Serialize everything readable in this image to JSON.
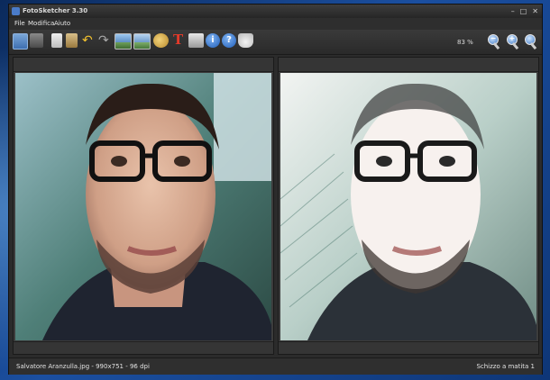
{
  "window": {
    "title": "FotoSketcher 3.30",
    "controls": [
      "–",
      "□",
      "✕"
    ]
  },
  "menu": {
    "items": [
      "File",
      "Modifica",
      "Aiuto"
    ]
  },
  "toolbar": {
    "icons": {
      "open": "open-image-icon",
      "save": "save-icon",
      "copy": "copy-icon",
      "paste": "paste-icon",
      "undo": "undo-icon",
      "redo": "redo-icon",
      "original": "original-image-icon",
      "result": "result-image-icon",
      "palette": "palette-icon",
      "text": "text-icon",
      "print": "print-icon",
      "info": "info-icon",
      "help": "help-icon",
      "coffee": "coffee-cup-icon"
    },
    "glyphs": {
      "undo": "↶",
      "redo": "↷",
      "text": "T",
      "info": "i",
      "help": "?"
    },
    "zoom_value": "83 %",
    "zoom_marks": [
      "−",
      "+",
      ""
    ]
  },
  "status": {
    "file_info": "Salvatore Aranzulla.jpg - 990x751 - 96 dpi",
    "effect": "Schizzo a matita 1"
  },
  "colors": {
    "accent": "#4a7bc8",
    "window_bg": "#2b2b2b",
    "titlebar": "#262626"
  }
}
